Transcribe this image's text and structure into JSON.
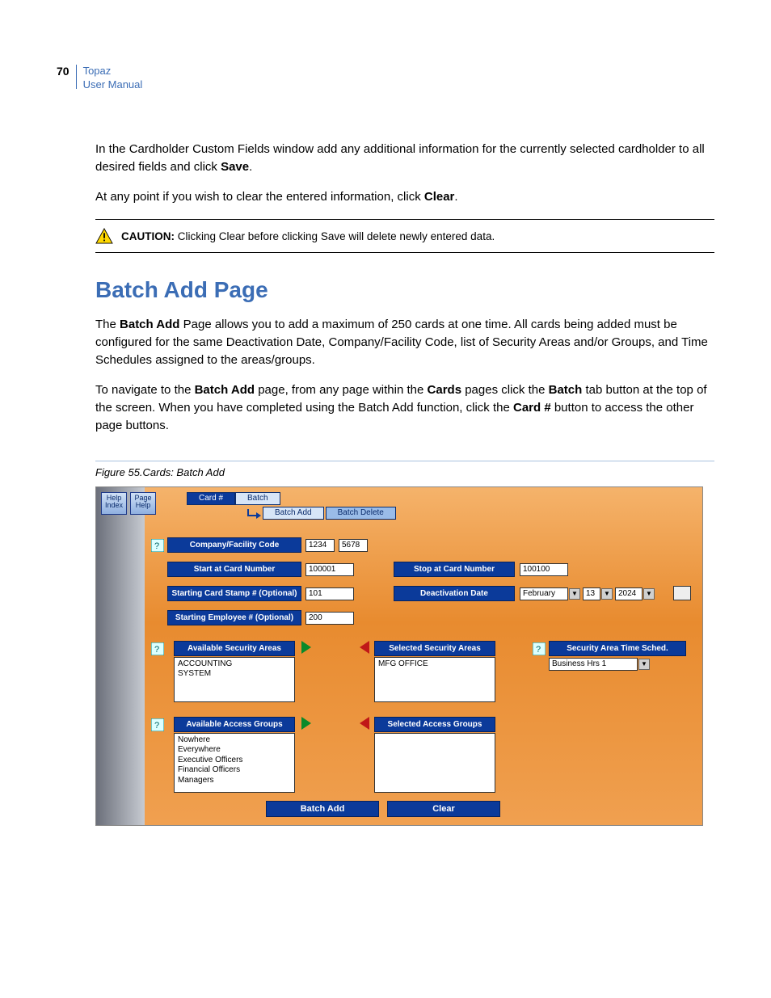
{
  "header": {
    "page_number": "70",
    "title_line1": "Topaz",
    "title_line2": "User Manual"
  },
  "intro": {
    "p1_a": "In the Cardholder Custom Fields window add any additional information for the currently selected cardholder to all desired fields and click ",
    "p1_b": "Save",
    "p1_c": ".",
    "p2_a": "At any point if you wish to clear the entered information, click ",
    "p2_b": "Clear",
    "p2_c": "."
  },
  "caution": {
    "label": "CAUTION:",
    "text": "  Clicking Clear before clicking Save will delete newly entered data."
  },
  "section": {
    "title": "Batch Add Page",
    "p1_a": "The ",
    "p1_b": "Batch Add",
    "p1_c": " Page allows you to add a maximum of 250 cards at one time. All cards being added must be configured for the same Deactivation Date, Company/Facility Code, list of Security Areas and/or Groups, and Time Schedules assigned to the areas/groups.",
    "p2_a": "To navigate to the ",
    "p2_b": "Batch Add",
    "p2_c": " page, from any page within the ",
    "p2_d": "Cards",
    "p2_e": " pages click the ",
    "p2_f": "Batch",
    "p2_g": " tab button at the top of the screen. When you have completed using the Batch Add function, click the ",
    "p2_h": "Card #",
    "p2_i": " button to access the other page buttons."
  },
  "figure": {
    "caption": "Figure 55.Cards: Batch Add"
  },
  "screenshot": {
    "topbar": {
      "help_index": "Help Index",
      "page_help": "Page Help",
      "tab_card_num": "Card #",
      "tab_batch": "Batch",
      "tab_batch_add": "Batch Add",
      "tab_batch_delete": "Batch Delete"
    },
    "labels": {
      "company_facility": "Company/Facility Code",
      "start_card": "Start at Card Number",
      "stop_card": "Stop at Card Number",
      "starting_stamp": "Starting Card Stamp # (Optional)",
      "starting_employee": "Starting Employee # (Optional)",
      "deactivation": "Deactivation Date",
      "avail_sec": "Available Security Areas",
      "sel_sec": "Selected Security Areas",
      "sec_time": "Security Area Time Sched.",
      "avail_grp": "Available Access Groups",
      "sel_grp": "Selected Access Groups"
    },
    "values": {
      "company_code": "1234",
      "facility_code": "5678",
      "start_card": "100001",
      "stop_card": "100100",
      "starting_stamp": "101",
      "starting_employee": "200",
      "deact_month": "February",
      "deact_day": "13",
      "deact_year": "2024",
      "avail_sec_items": [
        "ACCOUNTING",
        "SYSTEM"
      ],
      "sel_sec_items": [
        "MFG OFFICE"
      ],
      "time_sched": "Business Hrs 1",
      "avail_grp_items": [
        "Nowhere",
        "Everywhere",
        "Executive Officers",
        "Financial Officers",
        "Managers"
      ]
    },
    "buttons": {
      "batch_add": "Batch Add",
      "clear": "Clear"
    }
  }
}
